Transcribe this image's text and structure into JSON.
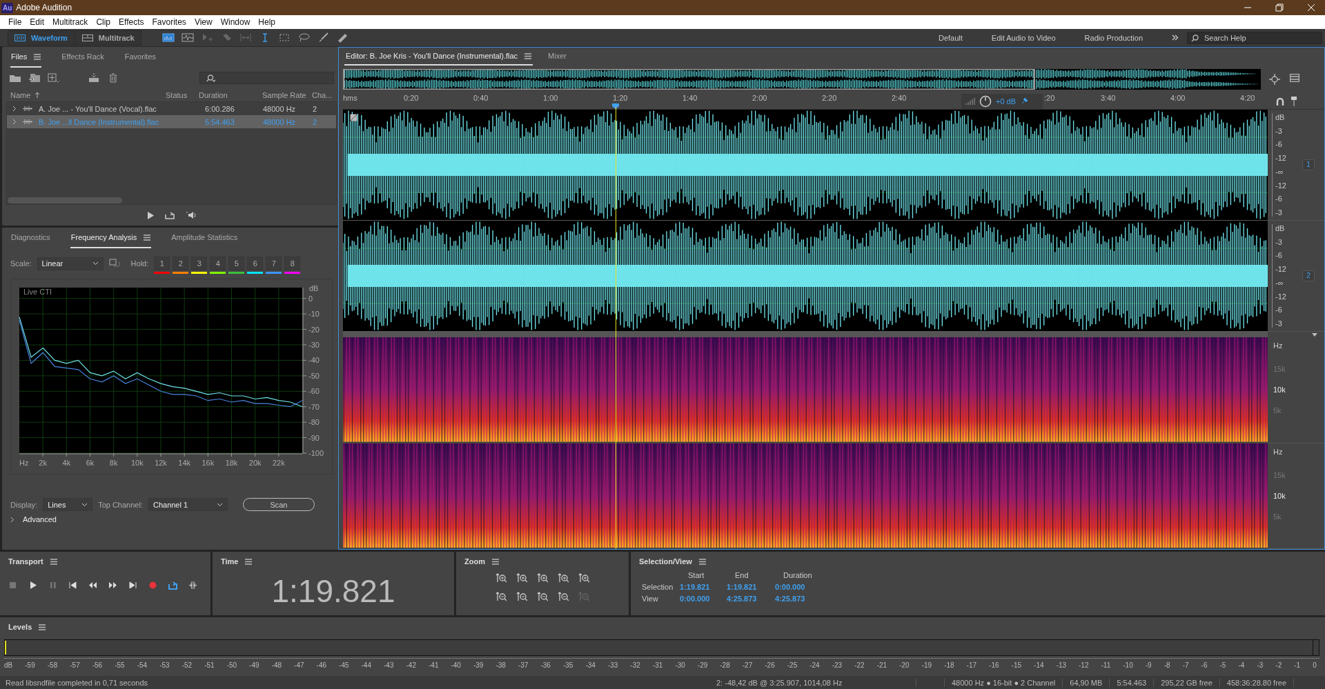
{
  "window": {
    "badge": "Au",
    "title": "Adobe Audition"
  },
  "menu": [
    "File",
    "Edit",
    "Multitrack",
    "Clip",
    "Effects",
    "Favorites",
    "View",
    "Window",
    "Help"
  ],
  "view_toggle": [
    {
      "label": "Waveform",
      "selected": true
    },
    {
      "label": "Multitrack",
      "selected": false
    }
  ],
  "workspaces": [
    "Default",
    "Edit Audio to Video",
    "Radio Production"
  ],
  "search_help": {
    "placeholder": "Search Help"
  },
  "files_panel": {
    "tabs": [
      {
        "label": "Files",
        "selected": true
      },
      {
        "label": "Effects Rack",
        "selected": false
      },
      {
        "label": "Favorites",
        "selected": false
      }
    ],
    "columns": [
      "Name",
      "Status",
      "Duration",
      "Sample Rate",
      "Cha..."
    ],
    "rows": [
      {
        "name": "A. Joe ... - You'll Dance (Vocal).flac",
        "duration": "6:00.286",
        "sample_rate": "48000 Hz",
        "channels": "2",
        "selected": false
      },
      {
        "name": "B. Joe ...ll Dance (Instrumental).flac",
        "duration": "5:54.463",
        "sample_rate": "48000 Hz",
        "channels": "2",
        "selected": true
      }
    ]
  },
  "analysis_panel": {
    "tabs": [
      {
        "label": "Diagnostics",
        "selected": false
      },
      {
        "label": "Frequency Analysis",
        "selected": true
      },
      {
        "label": "Amplitude Statistics",
        "selected": false
      }
    ],
    "scale_label": "Scale:",
    "scale": "Linear",
    "hold_label": "Hold:",
    "hold_buttons": [
      {
        "label": "1",
        "color": "#ff0000"
      },
      {
        "label": "2",
        "color": "#ff8000"
      },
      {
        "label": "3",
        "color": "#ffff00"
      },
      {
        "label": "4",
        "color": "#80ff00"
      },
      {
        "label": "5",
        "color": "#3cc03c"
      },
      {
        "label": "6",
        "color": "#00e5ff"
      },
      {
        "label": "7",
        "color": "#3c96ff"
      },
      {
        "label": "8",
        "color": "#ff00ff"
      }
    ],
    "graph_label": "Live CTI",
    "chart_data": {
      "type": "line",
      "xlabel": "Hz",
      "ylabel": "dB",
      "x": [
        0,
        1000,
        2000,
        3000,
        4000,
        5000,
        6000,
        7000,
        8000,
        9000,
        10000,
        11000,
        12000,
        13000,
        14000,
        15000,
        16000,
        17000,
        18000,
        19000,
        20000,
        21000,
        22000,
        23000,
        24000
      ],
      "series": [
        {
          "color": "#6fe3ea",
          "values": [
            -12,
            -38,
            -32,
            -40,
            -42,
            -40,
            -48,
            -50,
            -47,
            -52,
            -48,
            -52,
            -55,
            -57,
            -58,
            -60,
            -62,
            -61,
            -63,
            -63,
            -65,
            -64,
            -66,
            -67,
            -70
          ]
        },
        {
          "color": "#4a84e0",
          "values": [
            -14,
            -42,
            -35,
            -44,
            -45,
            -46,
            -52,
            -54,
            -50,
            -55,
            -52,
            -56,
            -60,
            -62,
            -62,
            -63,
            -66,
            -65,
            -67,
            -66,
            -68,
            -68,
            -69,
            -70,
            -66
          ]
        }
      ],
      "xlim": [
        0,
        24000
      ],
      "ylim": [
        -100,
        7
      ],
      "grid": true,
      "xticks": [
        {
          "value": 2000,
          "label": "2k"
        },
        {
          "value": 4000,
          "label": "4k"
        },
        {
          "value": 6000,
          "label": "6k"
        },
        {
          "value": 8000,
          "label": "8k"
        },
        {
          "value": 10000,
          "label": "10k"
        },
        {
          "value": 12000,
          "label": "12k"
        },
        {
          "value": 14000,
          "label": "14k"
        },
        {
          "value": 16000,
          "label": "16k"
        },
        {
          "value": 18000,
          "label": "18k"
        },
        {
          "value": 20000,
          "label": "20k"
        },
        {
          "value": 22000,
          "label": "22k"
        }
      ],
      "yticks": [
        0,
        -10,
        -20,
        -30,
        -40,
        -50,
        -60,
        -70,
        -80,
        -90,
        -100
      ]
    },
    "display_label": "Display:",
    "display": "Lines",
    "top_channel_label": "Top Channel:",
    "top_channel": "Channel 1",
    "scan": "Scan",
    "advanced": "Advanced"
  },
  "editor": {
    "tabs": [
      {
        "label": "Editor: B. Joe Kris - You'll Dance (Instrumental).flac",
        "selected": true
      },
      {
        "label": "Mixer",
        "selected": false
      }
    ],
    "ruler_start": [
      "hms",
      "0:20",
      "0:40",
      "1:00",
      "1:20",
      "1:40",
      "2:00",
      "2:20",
      "2:40"
    ],
    "volume": "+0 dB",
    "ruler_end": [
      ":20",
      "3:40",
      "4:00",
      "4:20"
    ],
    "channels": [
      {
        "badge": "1",
        "scale": [
          "dB",
          "-3",
          "-6",
          "-12",
          "-∞",
          "-12",
          "-6",
          "-3"
        ]
      },
      {
        "badge": "2",
        "scale": [
          "dB",
          "-3",
          "-6",
          "-12",
          "-∞",
          "-12",
          "-6",
          "-3"
        ]
      }
    ],
    "spectral": [
      {
        "scale": [
          "Hz",
          "15k",
          "10k",
          "5k"
        ]
      },
      {
        "scale": [
          "Hz",
          "15k",
          "10k",
          "5k"
        ]
      }
    ]
  },
  "transport": {
    "title": "Transport",
    "loop": true
  },
  "time": {
    "title": "Time",
    "value": "1:19.821"
  },
  "zoom": {
    "title": "Zoom"
  },
  "selection_view": {
    "title": "Selection/View",
    "columns": [
      "Start",
      "End",
      "Duration"
    ],
    "rows": [
      {
        "label": "Selection",
        "start": "1:19.821",
        "end": "1:19.821",
        "duration": "0:00.000"
      },
      {
        "label": "View",
        "start": "0:00.000",
        "end": "4:25.873",
        "duration": "4:25.873"
      }
    ]
  },
  "levels": {
    "title": "Levels",
    "scale": [
      "dB",
      "-59",
      "-58",
      "-57",
      "-56",
      "-55",
      "-54",
      "-53",
      "-52",
      "-51",
      "-50",
      "-49",
      "-48",
      "-47",
      "-46",
      "-45",
      "-44",
      "-43",
      "-42",
      "-41",
      "-40",
      "-39",
      "-38",
      "-37",
      "-36",
      "-35",
      "-34",
      "-33",
      "-32",
      "-31",
      "-30",
      "-29",
      "-28",
      "-27",
      "-26",
      "-25",
      "-24",
      "-23",
      "-22",
      "-21",
      "-20",
      "-19",
      "-18",
      "-17",
      "-16",
      "-15",
      "-14",
      "-13",
      "-12",
      "-11",
      "-10",
      "-9",
      "-8",
      "-7",
      "-6",
      "-5",
      "-4",
      "-3",
      "-2",
      "-1",
      "0"
    ]
  },
  "status_bar": {
    "message": "Read libsndfile completed in 0,71 seconds",
    "cursor": "2: -48,42 dB @ 3:25.907, 1014,08 Hz",
    "format": "48000 Hz ● 16-bit ● 2 Channel",
    "size": "64,90 MB",
    "duration": "5:54.463",
    "free_space": "295,22 GB free",
    "free_time": "458:36:28.80 free"
  }
}
